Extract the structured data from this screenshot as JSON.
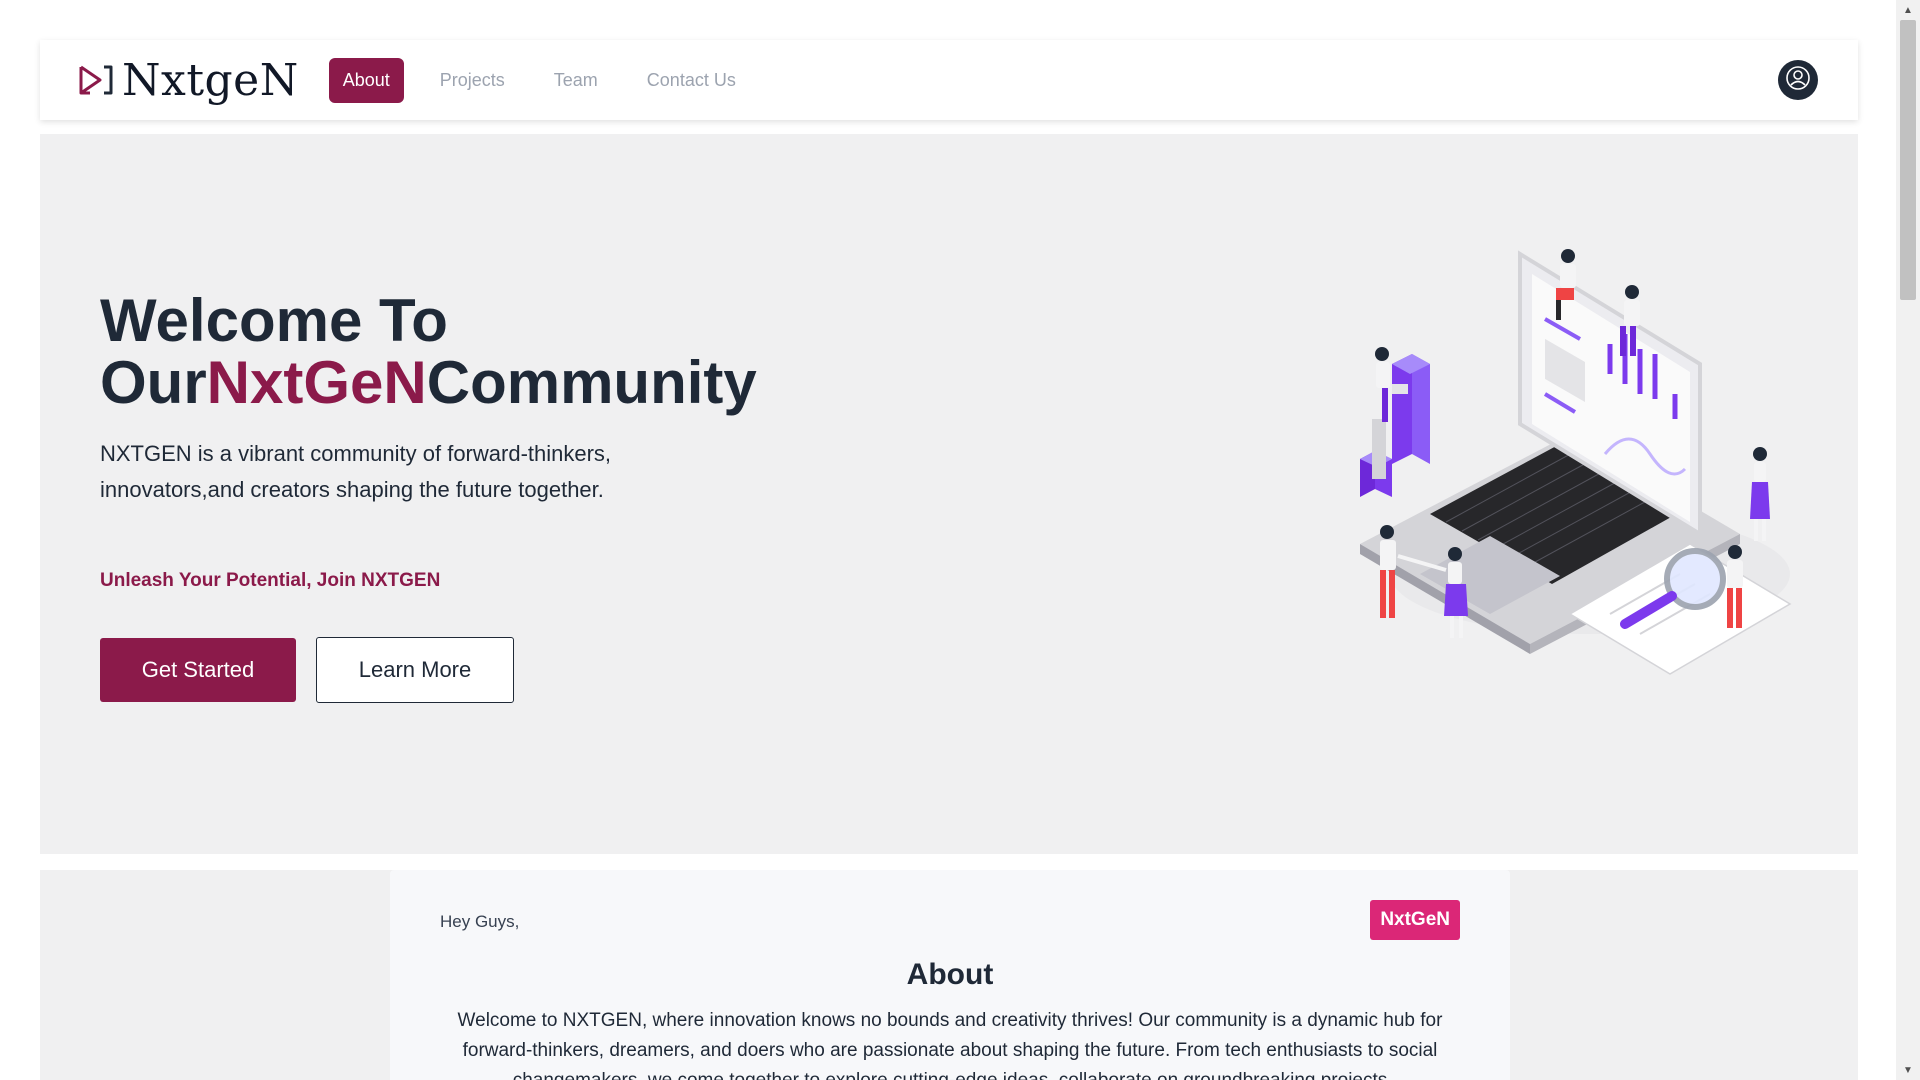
{
  "brand": {
    "name": "NxtgeN",
    "logo_icon": "play-bracket-icon",
    "accent_color": "#8b1a4a",
    "badge_color": "#db2777"
  },
  "nav": {
    "items": [
      {
        "label": "About",
        "active": true
      },
      {
        "label": "Projects",
        "active": false
      },
      {
        "label": "Team",
        "active": false
      },
      {
        "label": "Contact Us",
        "active": false
      }
    ],
    "avatar_icon": "user-circle-icon"
  },
  "hero": {
    "title_line1": "Welcome To",
    "title_prefix": "Our",
    "title_accent": "NxtGeN",
    "title_suffix": "Community",
    "description": "NXTGEN is a vibrant community of forward-thinkers, innovators,and creators shaping the future together.",
    "tagline": "Unleash Your Potential, Join NXTGEN",
    "primary_button": "Get Started",
    "secondary_button": "Learn More",
    "illustration": "isometric-laptop-team-illustration"
  },
  "about": {
    "greeting": "Hey Guys,",
    "badge": "NxtGeN",
    "title": "About",
    "text": "Welcome to NXTGEN, where innovation knows no bounds and creativity thrives! Our community is a dynamic hub for forward-thinkers, dreamers, and doers who are passionate about shaping the future. From tech enthusiasts to social changemakers, we come together to explore cutting-edge ideas, collaborate on groundbreaking projects"
  }
}
